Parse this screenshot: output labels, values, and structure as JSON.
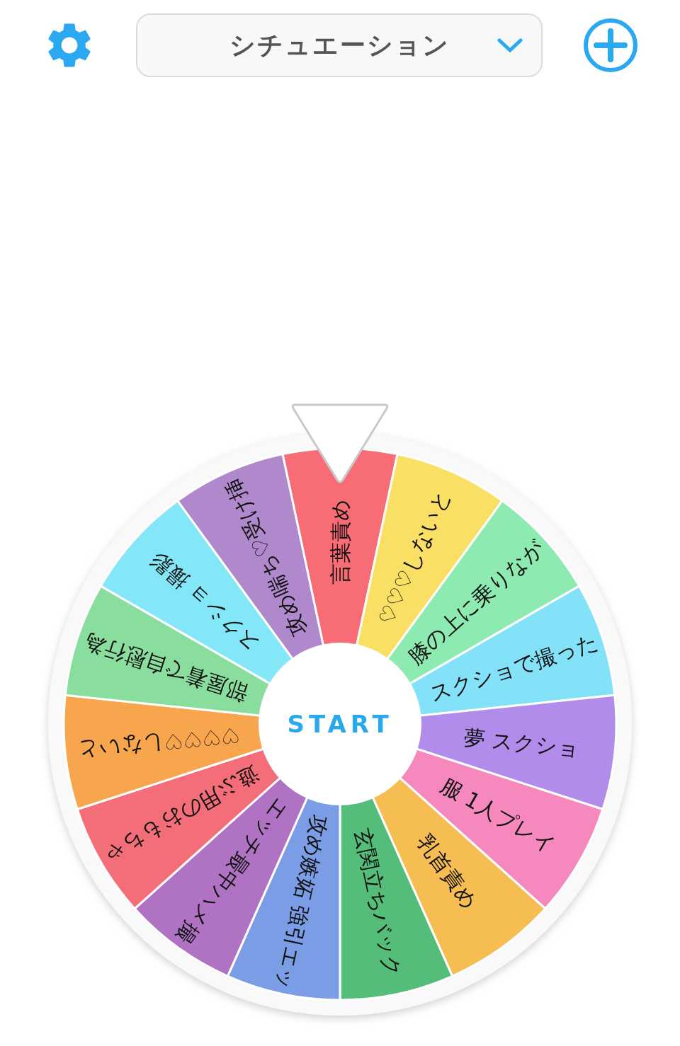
{
  "header": {
    "title": "シチュエーション"
  },
  "wheel": {
    "start_label": "START",
    "segments": [
      {
        "label": "言葉責め",
        "color": "#f76c75"
      },
      {
        "label": "♡♡♡しないと",
        "color": "#f9df63"
      },
      {
        "label": "膝の上に乗りなが",
        "color": "#8deab0"
      },
      {
        "label": "スクショで撮った",
        "color": "#84e2f8"
      },
      {
        "label": "夢 スクショ",
        "color": "#b18cea"
      },
      {
        "label": "服 1人プレイ",
        "color": "#f589bd"
      },
      {
        "label": "乳首責め",
        "color": "#f6bd53"
      },
      {
        "label": "玄関立ちバック",
        "color": "#55bd7a"
      },
      {
        "label": "攻め嫉妬 強引エッ",
        "color": "#7b9de6"
      },
      {
        "label": "エッチ最中ハメ撮",
        "color": "#b073c4"
      },
      {
        "label": "遊ぶ用のおもちゃ",
        "color": "#f46e79"
      },
      {
        "label": "♡♡♡♡しないと",
        "color": "#f7a64e"
      },
      {
        "label": "部屋着で自慰行為",
        "color": "#8ade9d"
      },
      {
        "label": "スクショ 撮影",
        "color": "#84e7f7"
      },
      {
        "label": "攻め喘ち♡受け挿",
        "color": "#b089cc"
      }
    ]
  }
}
